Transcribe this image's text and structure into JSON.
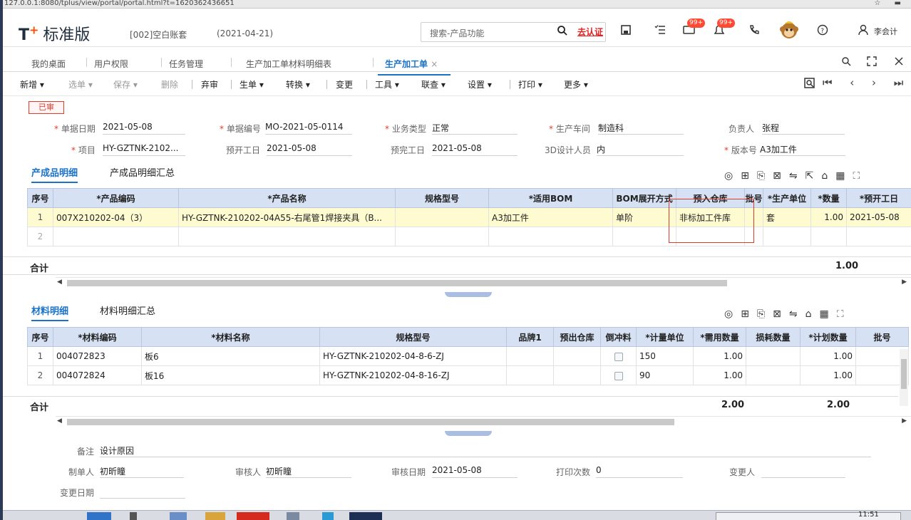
{
  "browser": {
    "url": "127.0.0.1:8080/tplus/view/portal/portal.html?t=1620362436651",
    "right_icons": "☆ ▬"
  },
  "header": {
    "logo_mark": "T",
    "logo_plus": "+",
    "product": "标准版",
    "account": "[002]空白账套",
    "date": "(2021-04-21)",
    "search_placeholder": "搜索-产品功能",
    "certify": "去认证",
    "badge1": "99+",
    "badge2": "99+",
    "user": "李会计"
  },
  "tabs": [
    {
      "label": "我的桌面"
    },
    {
      "label": "用户权限"
    },
    {
      "label": "任务管理"
    },
    {
      "label": "生产加工单材料明细表"
    },
    {
      "label": "生产加工单",
      "active": true,
      "close": "×"
    }
  ],
  "toolbar": {
    "items": [
      "新增 ▾",
      "选单 ▾",
      "保存 ▾",
      "删除",
      "弃审",
      "生单 ▾",
      "转换 ▾",
      "变更",
      "工具 ▾",
      "联查 ▾",
      "设置 ▾",
      "打印 ▾",
      "更多 ▾"
    ],
    "nav": "⏮ ‹ › ⏭"
  },
  "form": {
    "status": "已审",
    "doc_date_label": "单据日期",
    "doc_date": "2021-05-08",
    "doc_no_label": "单据编号",
    "doc_no": "MO-2021-05-0114",
    "biz_type_label": "业务类型",
    "biz_type": "正常",
    "workshop_label": "生产车间",
    "workshop": "制造科",
    "owner_label": "负责人",
    "owner": "张程",
    "project_label": "项目",
    "project": "HY-GZTNK-2102...",
    "start_label": "预开工日",
    "start": "2021-05-08",
    "end_label": "预完工日",
    "end": "2021-05-08",
    "designer_label": "3D设计人员",
    "designer": "内",
    "version_label": "版本号",
    "version": "A3加工件"
  },
  "products": {
    "tab_detail": "产成品明细",
    "tab_summary": "产成品明细汇总",
    "columns": [
      "序号",
      "*产品编码",
      "*产品名称",
      "规格型号",
      "*适用BOM",
      "BOM展开方式",
      "预入仓库",
      "批号",
      "*生产单位",
      "*数量",
      "*预开工日"
    ],
    "rows": [
      [
        "1",
        "007X210202-04（3）",
        "HY-GZTNK-210202-04A55-右尾管1焊接夹具（B...",
        "",
        "A3加工件",
        "单阶",
        "非标加工件库",
        "",
        "套",
        "1.00",
        "2021-05-08"
      ],
      [
        "2",
        "",
        "",
        "",
        "",
        "",
        "",
        "",
        "",
        "",
        ""
      ]
    ],
    "total_label": "合计",
    "total_qty": "1.00"
  },
  "materials": {
    "tab_detail": "材料明细",
    "tab_summary": "材料明细汇总",
    "columns": [
      "序号",
      "*材料编码",
      "*材料名称",
      "规格型号",
      "品牌1",
      "预出仓库",
      "倒冲料",
      "*计量单位",
      "*需用数量",
      "损耗数量",
      "*计划数量",
      "批号"
    ],
    "rows": [
      [
        "1",
        "004072823",
        "板6",
        "HY-GZTNK-210202-04-8-6-ZJ",
        "",
        "",
        "",
        "150",
        "1.00",
        "",
        "1.00",
        ""
      ],
      [
        "2",
        "004072824",
        "板16",
        "HY-GZTNK-210202-04-8-16-ZJ",
        "",
        "",
        "",
        "90",
        "1.00",
        "",
        "1.00",
        ""
      ]
    ],
    "total_label": "合计",
    "total_need": "2.00",
    "total_plan": "2.00"
  },
  "footer": {
    "remark_label": "备注",
    "remark": "设计原因",
    "maker_label": "制单人",
    "maker": "初昕瞳",
    "auditor_label": "审核人",
    "auditor": "初昕瞳",
    "audit_date_label": "审核日期",
    "audit_date": "2021-05-08",
    "print_count_label": "打印次数",
    "print_count": "0",
    "changer_label": "变更人",
    "changer": "",
    "change_date_label": "变更日期",
    "change_date": ""
  },
  "taskbar": {
    "clock": "11:51"
  },
  "colors": {
    "accent": "#1a73c8",
    "header_grid": "#d6e1f3",
    "selected_row": "#fffbd1",
    "alert": "#e03c2e"
  }
}
